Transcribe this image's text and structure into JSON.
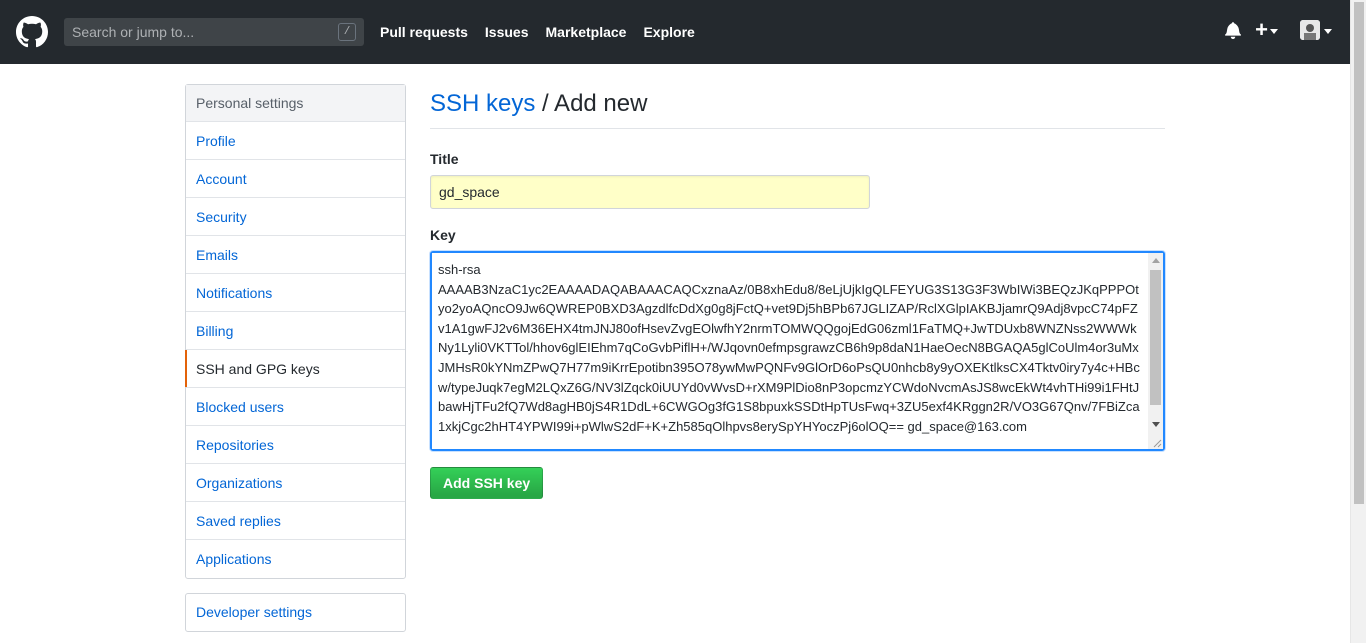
{
  "header": {
    "search_placeholder": "Search or jump to...",
    "search_shortcut": "/",
    "nav": [
      "Pull requests",
      "Issues",
      "Marketplace",
      "Explore"
    ],
    "plus": "+"
  },
  "sidebar": {
    "heading": "Personal settings",
    "items": [
      {
        "label": "Profile"
      },
      {
        "label": "Account"
      },
      {
        "label": "Security"
      },
      {
        "label": "Emails"
      },
      {
        "label": "Notifications"
      },
      {
        "label": "Billing"
      },
      {
        "label": "SSH and GPG keys",
        "selected": true
      },
      {
        "label": "Blocked users"
      },
      {
        "label": "Repositories"
      },
      {
        "label": "Organizations"
      },
      {
        "label": "Saved replies"
      },
      {
        "label": "Applications"
      }
    ],
    "developer_settings": "Developer settings"
  },
  "main": {
    "breadcrumb_link": "SSH keys",
    "breadcrumb_rest": " / Add new",
    "title_label": "Title",
    "title_value": "gd_space",
    "key_label": "Key",
    "key_value": "ssh-rsa\nAAAAB3NzaC1yc2EAAAADAQABAAACAQCxznaAz/0B8xhEdu8/8eLjUjkIgQLFEYUG3S13G3F3WbIWi3BEQzJKqPPPOtyo2yoAQncO9Jw6QWREP0BXD3AgzdlfcDdXg0g8jFctQ+vet9Dj5hBPb67JGLIZAP/RclXGlpIAKBJjamrQ9Adj8vpcC74pFZv1A1gwFJ2v6M36EHX4tmJNJ80ofHsevZvgEOlwfhY2nrmTOMWQQgojEdG06zml1FaTMQ+JwTDUxb8WNZNss2WWWkNy1Lyli0VKTTol/hhov6glEIEhm7qCoGvbPiflH+/WJqovn0efmpsgrawzCB6h9p8daN1HaeOecN8BGAQA5glCoUlm4or3uMxJMHsR0kYNmZPwQ7H77m9iKrrEpotibn395O78ywMwPQNFv9GlOrD6oPsQU0nhcb8y9yOXEKtlksCX4Tktv0iry7y4c+HBcw/typeJuqk7egM2LQxZ6G/NV3lZqck0iUUYd0vWvsD+rXM9PlDio8nP3opcmzYCWdoNvcmAsJS8wcEkWt4vhTHi99i1FHtJbawHjTFu2fQ7Wd8agHB0jS4R1DdL+6CWGOg3fG1S8bpuxkSSDtHpTUsFwq+3ZU5exf4KRggn2R/VO3G67Qnv/7FBiZca1xkjCgc2hHT4YPWI99i+pWlwS2dF+K+Zh585qOlhpvs8erySpYHYoczPj6olOQ== gd_space@163.com",
    "submit_label": "Add SSH key"
  }
}
